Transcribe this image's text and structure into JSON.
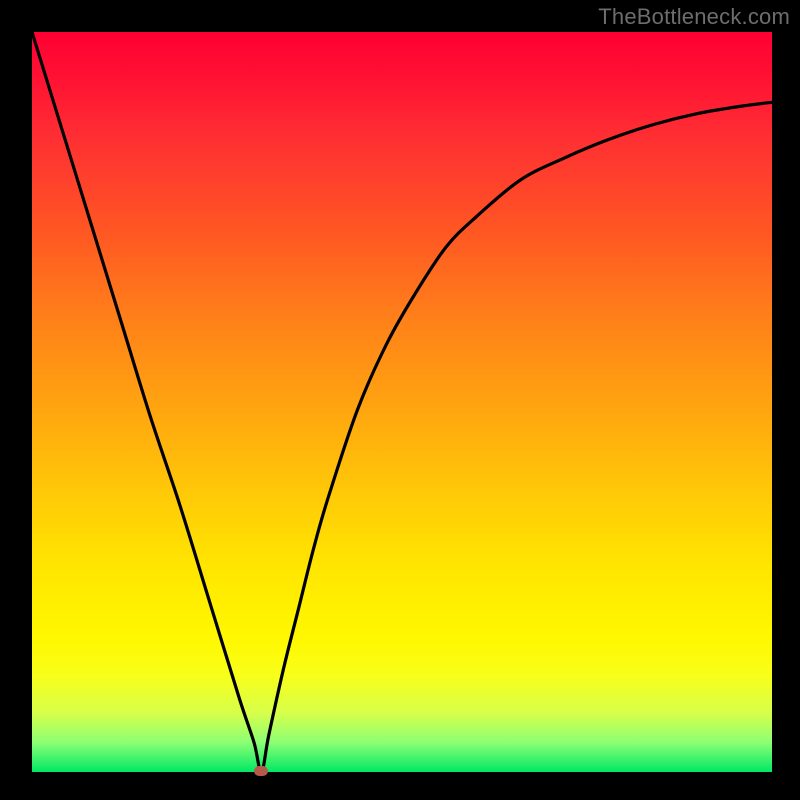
{
  "watermark": "TheBottleneck.com",
  "chart_data": {
    "type": "line",
    "title": "",
    "xlabel": "",
    "ylabel": "",
    "xlim": [
      0,
      100
    ],
    "ylim": [
      0,
      100
    ],
    "grid": false,
    "legend": false,
    "annotations": [
      {
        "type": "marker",
        "x": 31,
        "y": 0,
        "shape": "pill",
        "color": "#b35a4a"
      }
    ],
    "gradient_stops": [
      {
        "pos": 0.0,
        "color": "#ff0033"
      },
      {
        "pos": 0.14,
        "color": "#ff2e33"
      },
      {
        "pos": 0.28,
        "color": "#ff5a22"
      },
      {
        "pos": 0.5,
        "color": "#ffa210"
      },
      {
        "pos": 0.72,
        "color": "#ffe500"
      },
      {
        "pos": 0.87,
        "color": "#f8ff1a"
      },
      {
        "pos": 0.96,
        "color": "#8cff74"
      },
      {
        "pos": 1.0,
        "color": "#00e865"
      }
    ],
    "series": [
      {
        "name": "curve",
        "color": "#000000",
        "x": [
          0,
          4,
          8,
          12,
          16,
          20,
          24,
          28,
          30,
          31,
          32,
          34,
          36,
          38,
          40,
          44,
          48,
          52,
          56,
          60,
          66,
          72,
          78,
          84,
          90,
          96,
          100
        ],
        "values": [
          100,
          87,
          74,
          61,
          48,
          36,
          23,
          10,
          4,
          0,
          5,
          14,
          22,
          30,
          37,
          49,
          58,
          65,
          71,
          75,
          80,
          83,
          85.5,
          87.5,
          89,
          90,
          90.5
        ]
      }
    ]
  }
}
